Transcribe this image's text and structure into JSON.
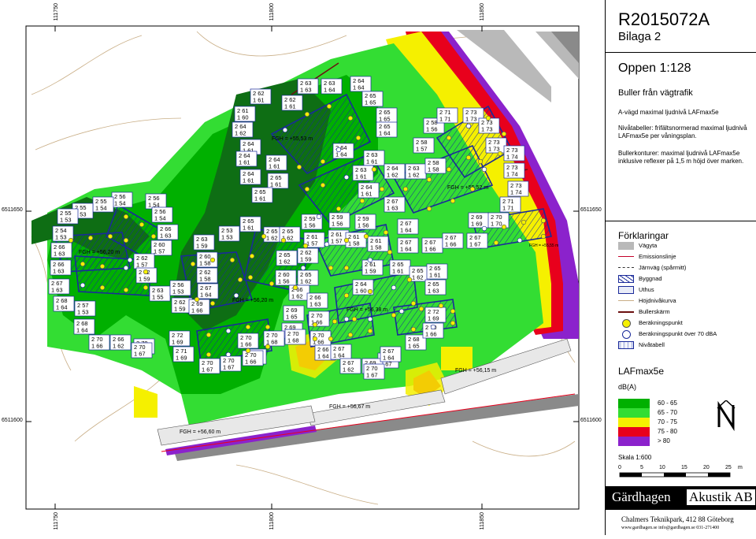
{
  "map": {
    "coords_top": [
      "111750",
      "111800",
      "111850"
    ],
    "coords_bottom": [
      "111750",
      "111800",
      "111850"
    ],
    "coords_side": [
      "6511650",
      "6511600"
    ],
    "fgh_labels": [
      "FGH = +55,53 m",
      "FGH = +55,52 m",
      "FGH = +56,20 m",
      "FGH = +56,20 m",
      "FGH = +56,38 m",
      "FGH = +55,55 m",
      "FGH = +56,15 m",
      "FGH = +56,67 m",
      "FGH = +56,60 m"
    ],
    "tables": [
      {
        "a": "2 63",
        "b": "1 63"
      },
      {
        "a": "2 63",
        "b": "1 64"
      },
      {
        "a": "2 64",
        "b": "1 64"
      },
      {
        "a": "2 62",
        "b": "1 61"
      },
      {
        "a": "2 62",
        "b": "1 61"
      },
      {
        "a": "2 65",
        "b": "1 65"
      },
      {
        "a": "2 61",
        "b": "1 60"
      },
      {
        "a": "2 65",
        "b": "1 65"
      },
      {
        "a": "2 64",
        "b": "1 62"
      },
      {
        "a": "2 65",
        "b": "1 64"
      },
      {
        "a": "2 64",
        "b": "1 61"
      },
      {
        "a": "2 64",
        "b": "1 61"
      },
      {
        "a": "2 64",
        "b": "1 64"
      },
      {
        "a": "2 63",
        "b": "1 61"
      },
      {
        "a": "2 64",
        "b": "1 61"
      },
      {
        "a": "2 65",
        "b": "1 61"
      },
      {
        "a": "2 63",
        "b": "1 61"
      },
      {
        "a": "2 64",
        "b": "1 61"
      },
      {
        "a": "2 65",
        "b": "1 61"
      },
      {
        "a": "2 64",
        "b": "1 61"
      },
      {
        "a": "2 64",
        "b": "1 62"
      },
      {
        "a": "2 63",
        "b": "1 62"
      },
      {
        "a": "2 58",
        "b": "1 56"
      },
      {
        "a": "2 71",
        "b": "1 71"
      },
      {
        "a": "2 73",
        "b": "1 73"
      },
      {
        "a": "2 73",
        "b": "1 73"
      },
      {
        "a": "2 58",
        "b": "1 57"
      },
      {
        "a": "2 58",
        "b": "1 58"
      },
      {
        "a": "2 73",
        "b": "1 73"
      },
      {
        "a": "2 73",
        "b": "1 74"
      },
      {
        "a": "2 73",
        "b": "1 74"
      },
      {
        "a": "2 73",
        "b": "1 74"
      },
      {
        "a": "2 56",
        "b": "1 54"
      },
      {
        "a": "2 56",
        "b": "1 54"
      },
      {
        "a": "2 55",
        "b": "1 54"
      },
      {
        "a": "2 55",
        "b": "1 53"
      },
      {
        "a": "2 55",
        "b": "1 53"
      },
      {
        "a": "2 56",
        "b": "1 54"
      },
      {
        "a": "2 54",
        "b": "1 53"
      },
      {
        "a": "2 66",
        "b": "1 63"
      },
      {
        "a": "2 65",
        "b": "1 61"
      },
      {
        "a": "2 65",
        "b": "1 62"
      },
      {
        "a": "2 67",
        "b": "1 63"
      },
      {
        "a": "2 59",
        "b": "1 56"
      },
      {
        "a": "2 59",
        "b": "1 56"
      },
      {
        "a": "2 59",
        "b": "1 56"
      },
      {
        "a": "2 67",
        "b": "1 64"
      },
      {
        "a": "2 69",
        "b": "1 69"
      },
      {
        "a": "2 70",
        "b": "1 70"
      },
      {
        "a": "2 71",
        "b": "1 71"
      },
      {
        "a": "2 66",
        "b": "1 63"
      },
      {
        "a": "2 60",
        "b": "1 57"
      },
      {
        "a": "2 63",
        "b": "1 59"
      },
      {
        "a": "2 53",
        "b": "1 53"
      },
      {
        "a": "2 65",
        "b": "1 62"
      },
      {
        "a": "2 65",
        "b": "1 62"
      },
      {
        "a": "2 61",
        "b": "1 57"
      },
      {
        "a": "2 61",
        "b": "1 57"
      },
      {
        "a": "2 61",
        "b": "1 58"
      },
      {
        "a": "2 61",
        "b": "1 58"
      },
      {
        "a": "2 67",
        "b": "1 64"
      },
      {
        "a": "2 67",
        "b": "1 66"
      },
      {
        "a": "2 67",
        "b": "1 66"
      },
      {
        "a": "2 67",
        "b": "1 67"
      },
      {
        "a": "2 66",
        "b": "1 63"
      },
      {
        "a": "2 62",
        "b": "1 57"
      },
      {
        "a": "2 60",
        "b": "1 58"
      },
      {
        "a": "2 62",
        "b": "1 59"
      },
      {
        "a": "2 65",
        "b": "1 61"
      },
      {
        "a": "2 65",
        "b": "1 62"
      },
      {
        "a": "2 60",
        "b": "1 56"
      },
      {
        "a": "2 61",
        "b": "1 59"
      },
      {
        "a": "2 67",
        "b": "1 63"
      },
      {
        "a": "2 62",
        "b": "1 59"
      },
      {
        "a": "2 62",
        "b": "1 58"
      },
      {
        "a": "2 65",
        "b": "1 62"
      },
      {
        "a": "2 65",
        "b": "1 61"
      },
      {
        "a": "2 65",
        "b": "1 63"
      },
      {
        "a": "2 67",
        "b": "1 64"
      },
      {
        "a": "2 63",
        "b": "1 55"
      },
      {
        "a": "2 56",
        "b": "1 53"
      },
      {
        "a": "2 66",
        "b": "1 62"
      },
      {
        "a": "2 64",
        "b": "1 60"
      },
      {
        "a": "2 66",
        "b": "1 63"
      },
      {
        "a": "2 68",
        "b": "1 64"
      },
      {
        "a": "2 57",
        "b": "1 53"
      },
      {
        "a": "2 62",
        "b": "1 59"
      },
      {
        "a": "2 69",
        "b": "1 66"
      },
      {
        "a": "2 68",
        "b": "1 64"
      },
      {
        "a": "2 72",
        "b": "1 69"
      },
      {
        "a": "2 70",
        "b": "1 66"
      },
      {
        "a": "2 66",
        "b": "1 62"
      },
      {
        "a": "2 68",
        "b": "1 65"
      },
      {
        "a": "2 70",
        "b": "1 68"
      },
      {
        "a": "2 72",
        "b": "1 69"
      },
      {
        "a": "2 69",
        "b": "1 65"
      },
      {
        "a": "2 69",
        "b": "1 65"
      },
      {
        "a": "2 70",
        "b": "1 66"
      },
      {
        "a": "2 70",
        "b": "1 66"
      },
      {
        "a": "2 71",
        "b": "1 69"
      },
      {
        "a": "2 70",
        "b": "1 67"
      },
      {
        "a": "2 70",
        "b": "1 67"
      },
      {
        "a": "2 70",
        "b": "1 66"
      },
      {
        "a": "2 70",
        "b": "1 68"
      },
      {
        "a": "2 70",
        "b": "1 68"
      },
      {
        "a": "2 70",
        "b": "1 66"
      },
      {
        "a": "2 65",
        "b": "1 64"
      },
      {
        "a": "2 66",
        "b": "1 64"
      },
      {
        "a": "2 67",
        "b": "1 64"
      },
      {
        "a": "2 70",
        "b": "1 67"
      },
      {
        "a": "2 67",
        "b": "1 62"
      },
      {
        "a": "2 69",
        "b": "1 66"
      },
      {
        "a": "2 67",
        "b": "1 64"
      },
      {
        "a": "2 70",
        "b": "1 67"
      },
      {
        "a": "2 70",
        "b": "1 66"
      },
      {
        "a": "2 70",
        "b": "1 67"
      }
    ]
  },
  "side": {
    "title": "R2015072A",
    "subtitle": "Bilaga 2",
    "scale_title": "Oppen 1:128",
    "heading": "Buller från vägtrafik",
    "desc1": "A-vägd maximal ljudnivå LAFmax5e",
    "desc2": "Nivåtabeller: frifältsnormerad maximal ljudnivå LAFmax5e per våningsplan.",
    "desc3": "Bullerkonturer: maximal ljudnivå LAFmax5e inklusive reflexer på 1,5 m höjd över marken.",
    "legend_title": "Förklaringar",
    "legend": [
      {
        "label": "Vägyta",
        "icon": "road-swatch"
      },
      {
        "label": "Emissionslinje",
        "icon": "emission-line"
      },
      {
        "label": "Järnväg (spårmitt)",
        "icon": "rail-line"
      },
      {
        "label": "Byggnad",
        "icon": "building-symbol"
      },
      {
        "label": "Uthus",
        "icon": "outbuilding-symbol"
      },
      {
        "label": "Höjdnivåkurva",
        "icon": "contour-line"
      },
      {
        "label": "Bullerskärm",
        "icon": "noise-barrier-line"
      },
      {
        "label": "Beräkningspunkt",
        "icon": "calc-point-icon"
      },
      {
        "label": "Beräkningspunkt över 70 dBA",
        "icon": "calc-point-over-icon"
      },
      {
        "label": "Nivåtabell",
        "icon": "level-table-icon"
      }
    ],
    "unit_label": "LAFmax5e",
    "unit": "dB(A)",
    "noise_bands": [
      {
        "label": "60  -  65",
        "color": "#00b000"
      },
      {
        "label": "65  -  70",
        "color": "#33dd33"
      },
      {
        "label": "70  -  75",
        "color": "#f5f000"
      },
      {
        "label": "75  -  80",
        "color": "#e8001c"
      },
      {
        "label": ">  80",
        "color": "#8b22cc"
      }
    ],
    "north": "N",
    "scale_label": "Skala 1:600",
    "scale_ticks": [
      "0",
      "5",
      "10",
      "15",
      "20",
      "25"
    ],
    "scale_unit": "m",
    "company_a": "Gärdhagen",
    "company_b": "Akustik AB",
    "address": "Chalmers Teknikpark, 412 88 Göteborg",
    "contact": "www.gardhagen.se  info@gardhagen.se  031-271400"
  }
}
